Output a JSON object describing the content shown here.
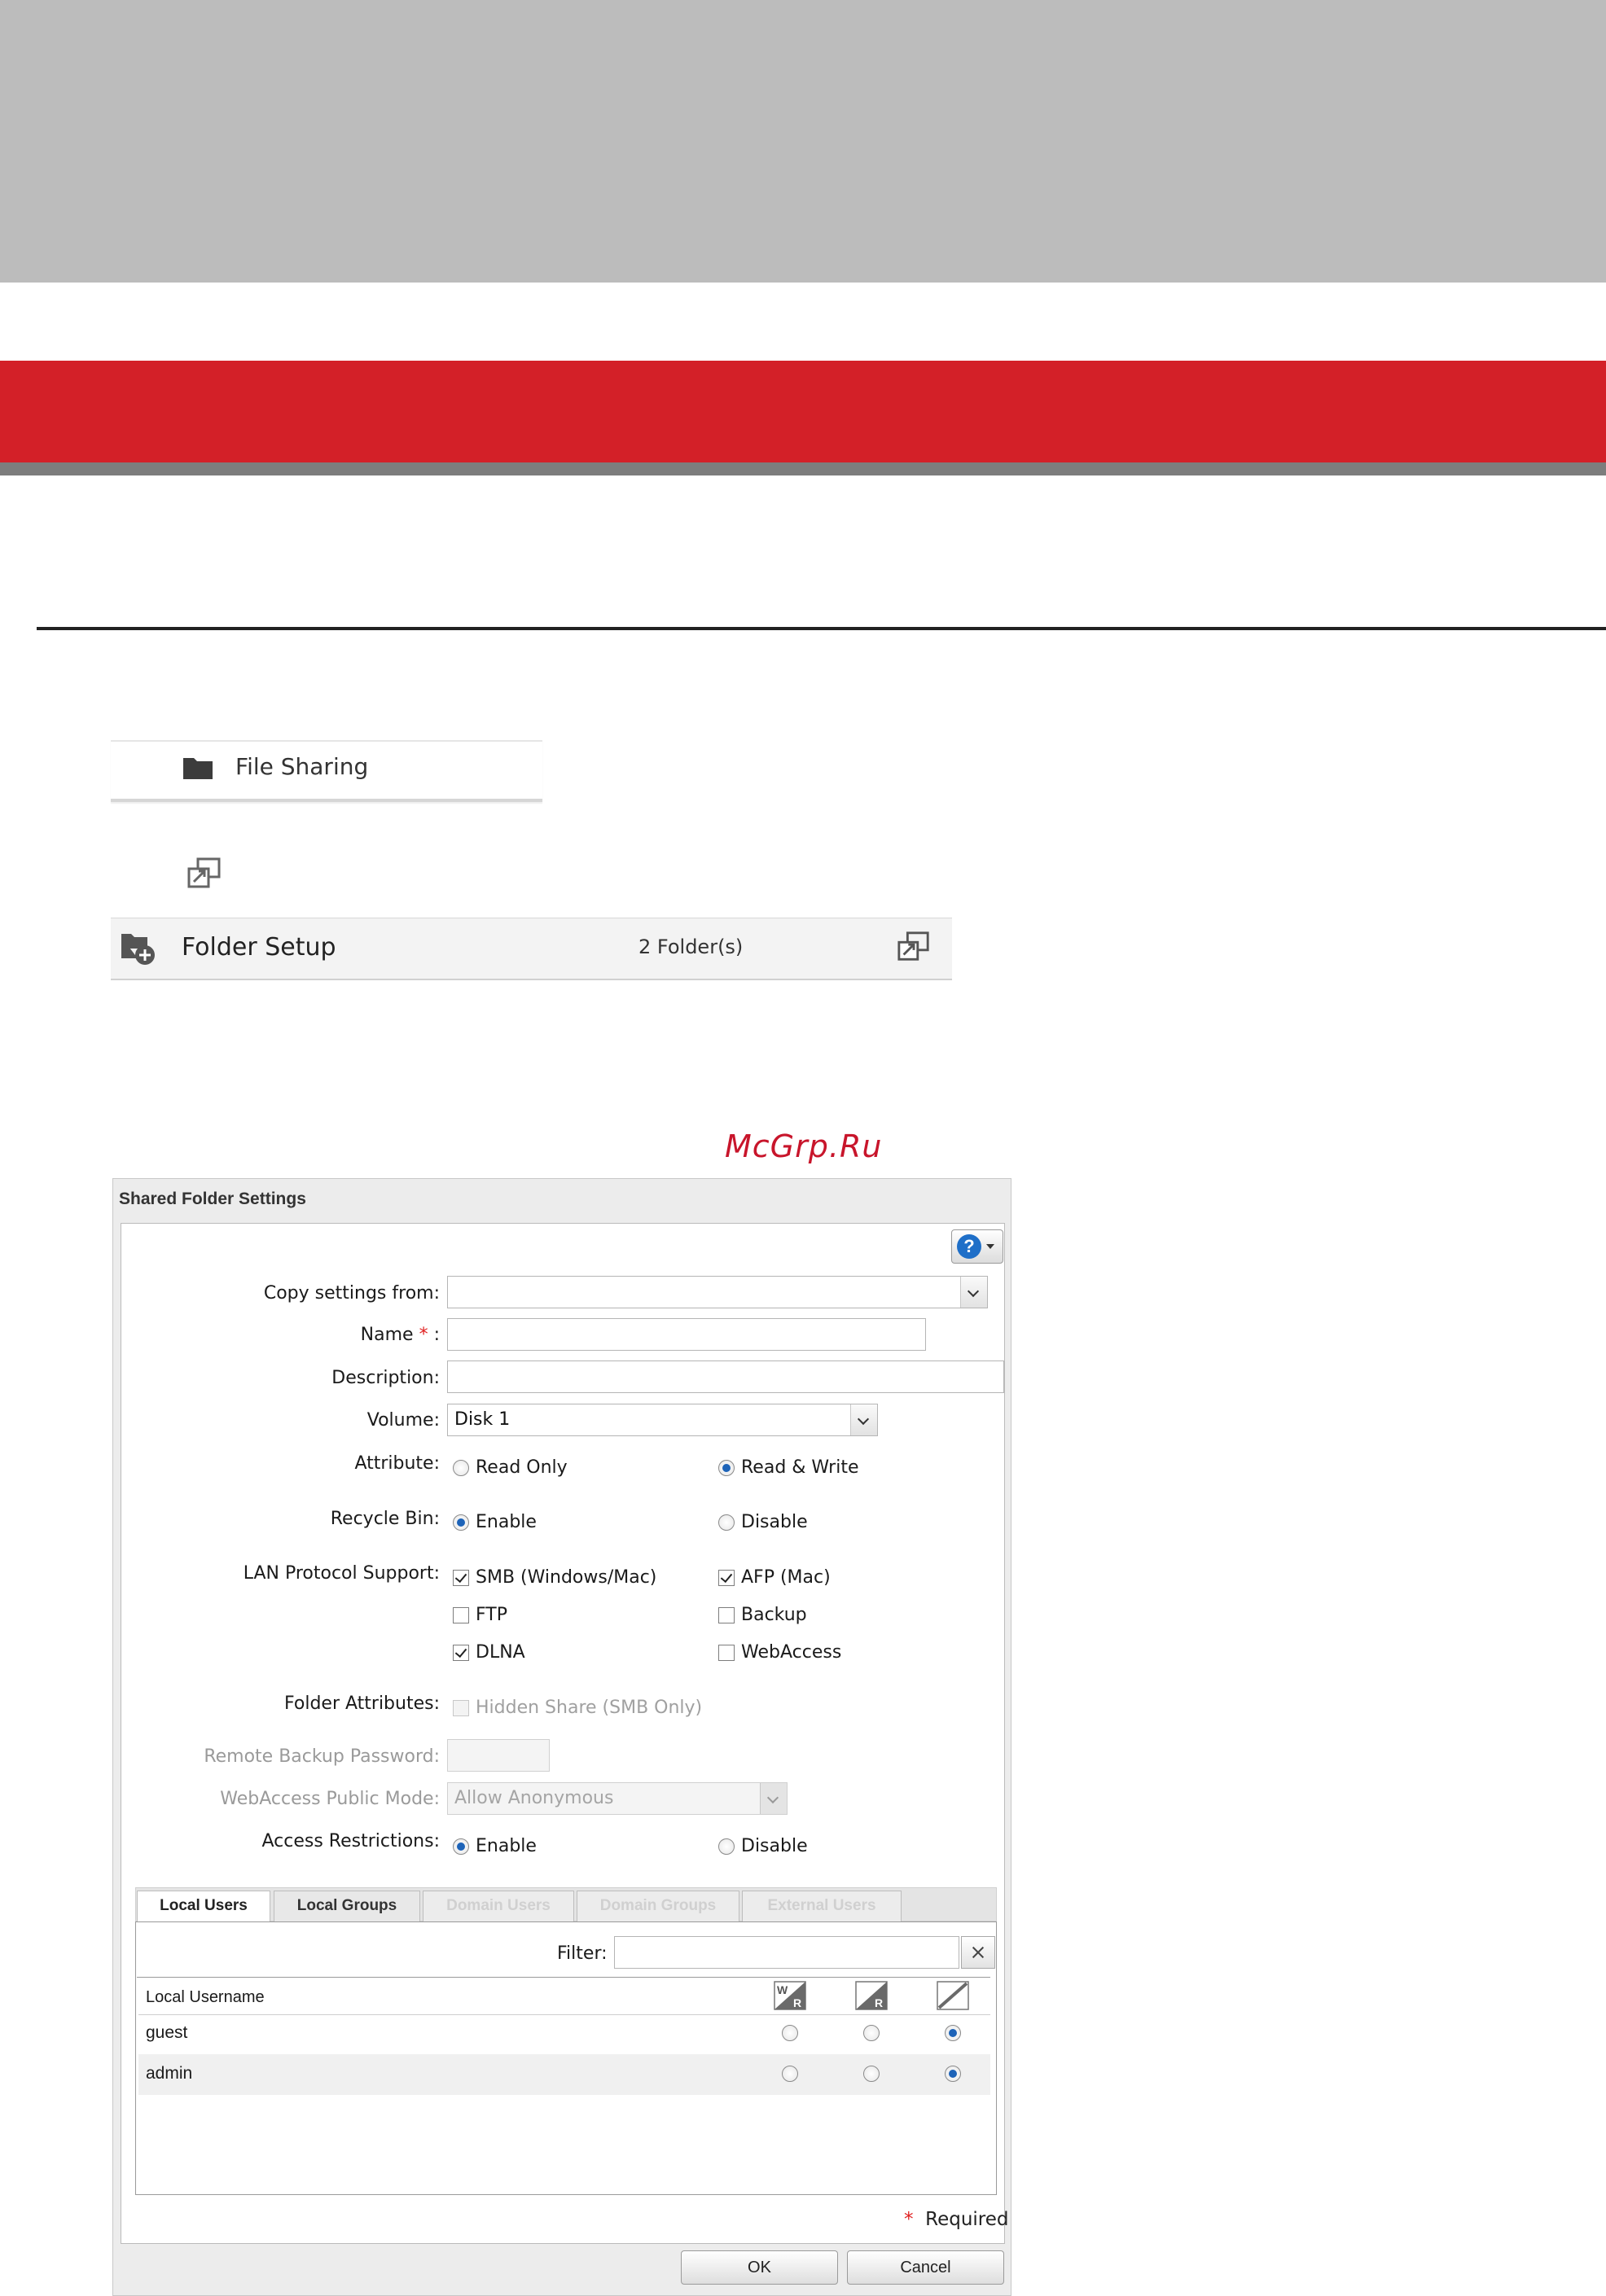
{
  "menu": {
    "file_sharing": "File Sharing"
  },
  "folder_setup": {
    "label": "Folder Setup",
    "count": "2 Folder(s)"
  },
  "watermark": "McGrp.Ru",
  "dialog": {
    "title": "Shared Folder Settings",
    "copy_settings_label": "Copy settings from:",
    "copy_settings_value": "",
    "name_label": "Name",
    "name_star": "*",
    "name_colon": ":",
    "name_value": "",
    "description_label": "Description:",
    "description_value": "",
    "volume_label": "Volume:",
    "volume_value": "Disk 1",
    "attribute_label": "Attribute:",
    "attribute_options": [
      "Read Only",
      "Read & Write"
    ],
    "attribute_selected": "Read & Write",
    "recycle_label": "Recycle Bin:",
    "recycle_options": [
      "Enable",
      "Disable"
    ],
    "recycle_selected": "Enable",
    "lan_label": "LAN Protocol Support:",
    "lan_options": [
      {
        "label": "SMB (Windows/Mac)",
        "checked": true
      },
      {
        "label": "AFP (Mac)",
        "checked": true
      },
      {
        "label": "FTP",
        "checked": false
      },
      {
        "label": "Backup",
        "checked": false
      },
      {
        "label": "DLNA",
        "checked": true
      },
      {
        "label": "WebAccess",
        "checked": false
      }
    ],
    "folder_attr_label": "Folder Attributes:",
    "folder_attr_option": "Hidden Share (SMB Only)",
    "remote_backup_label": "Remote Backup Password:",
    "webaccess_mode_label": "WebAccess Public Mode:",
    "webaccess_mode_value": "Allow Anonymous",
    "access_label": "Access Restrictions:",
    "access_options": [
      "Enable",
      "Disable"
    ],
    "access_selected": "Enable",
    "tabs": [
      {
        "label": "Local Users",
        "state": "active"
      },
      {
        "label": "Local Groups",
        "state": "normal"
      },
      {
        "label": "Domain Users",
        "state": "disabled"
      },
      {
        "label": "Domain Groups",
        "state": "disabled"
      },
      {
        "label": "External Users",
        "state": "disabled"
      }
    ],
    "filter_label": "Filter:",
    "filter_value": "",
    "grid_header": "Local Username",
    "perm_icons": [
      "read-write-icon",
      "read-only-icon",
      "no-access-icon"
    ],
    "users": [
      {
        "name": "guest",
        "permission": "no-access"
      },
      {
        "name": "admin",
        "permission": "no-access"
      }
    ],
    "required_star": "*",
    "required_text": "Required",
    "ok": "OK",
    "cancel": "Cancel"
  },
  "colors": {
    "accent_red": "#d32028",
    "radio_blue": "#1d63b8",
    "help_blue": "#1f6fc8"
  }
}
